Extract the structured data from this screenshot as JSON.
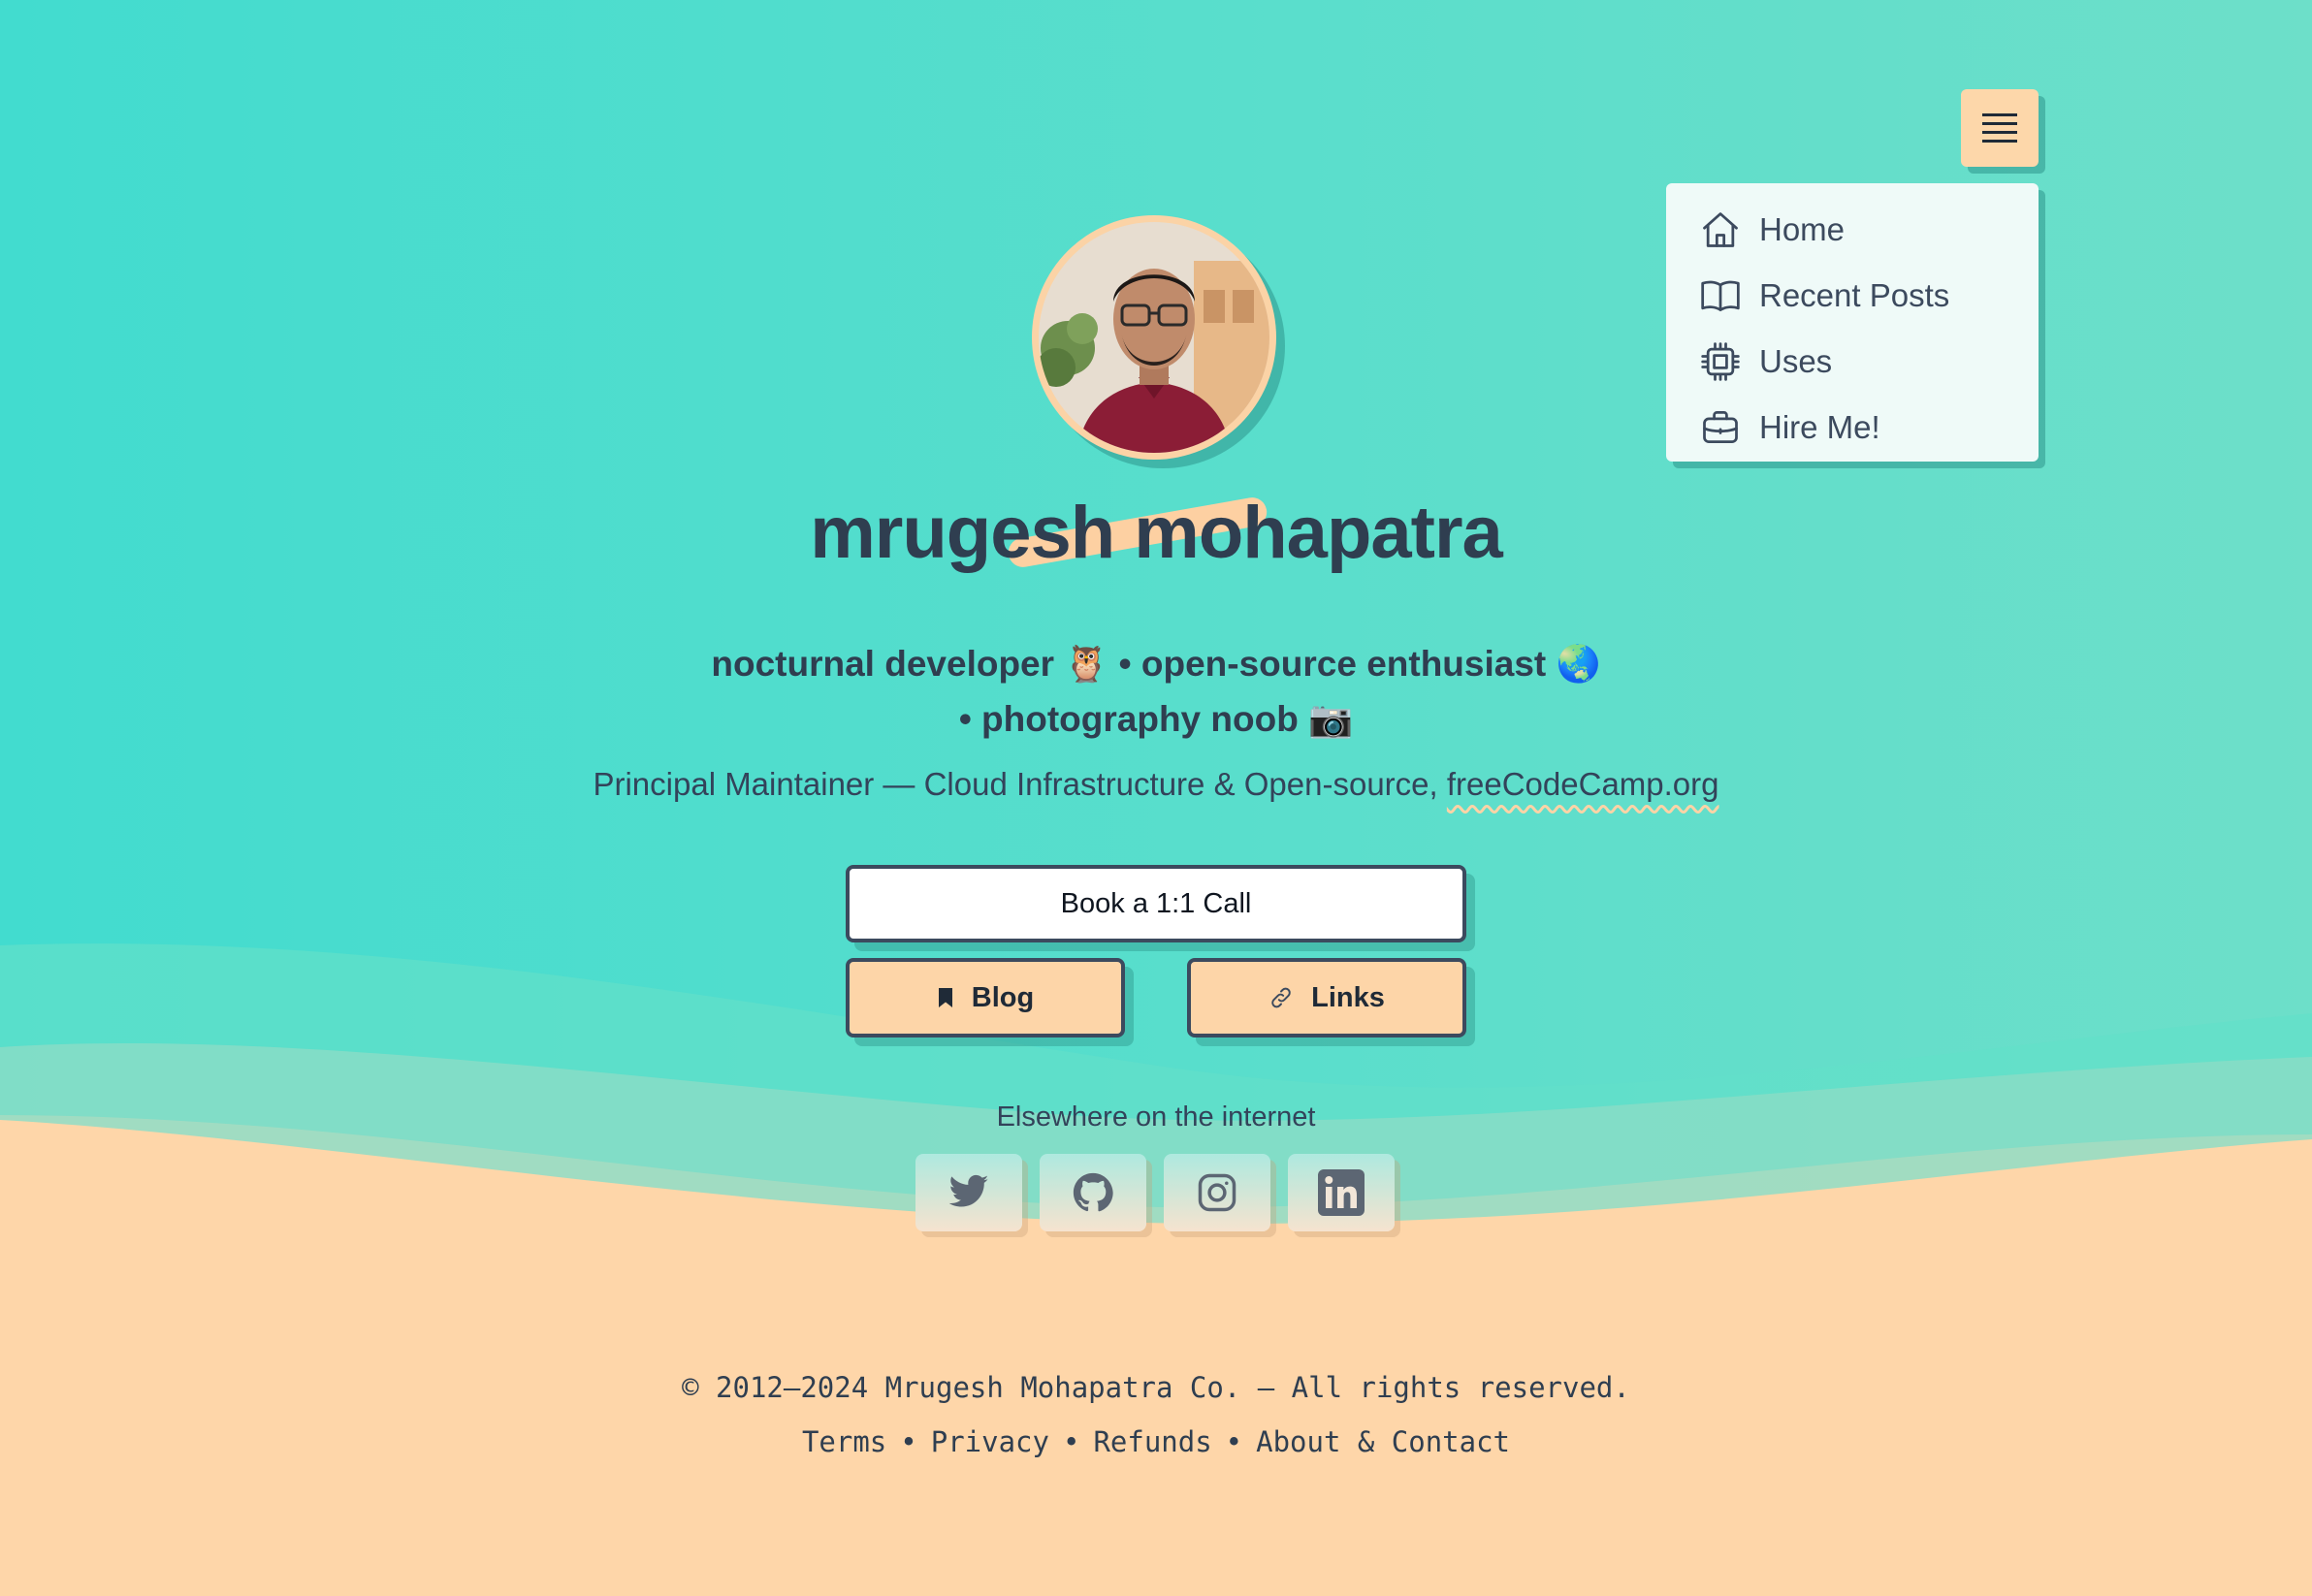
{
  "menu": {
    "items": [
      {
        "label": "Home",
        "icon": "home-icon"
      },
      {
        "label": "Recent Posts",
        "icon": "book-open-icon"
      },
      {
        "label": "Uses",
        "icon": "chip-icon"
      },
      {
        "label": "Hire Me!",
        "icon": "briefcase-icon"
      }
    ]
  },
  "profile": {
    "name": "mrugesh mohapatra",
    "tagline_line1": "nocturnal developer 🦉 • open-source enthusiast 🌏",
    "tagline_line2": "• photography noob 📷",
    "role_prefix": "Principal Maintainer — Cloud Infrastructure & Open-source, ",
    "role_link": "freeCodeCamp.org"
  },
  "buttons": {
    "call": "Book a 1:1 Call",
    "blog": "Blog",
    "links": "Links"
  },
  "elsewhere": {
    "label": "Elsewhere on the internet",
    "icons": [
      "twitter-icon",
      "github-icon",
      "instagram-icon",
      "linkedin-icon"
    ]
  },
  "footer": {
    "copyright": "© 2012–2024 Mrugesh Mohapatra Co. — All rights reserved.",
    "links": [
      "Terms",
      "Privacy",
      "Refunds",
      "About & Contact"
    ],
    "separator": "•"
  },
  "colors": {
    "teal": "#44ddd0",
    "peach": "#fed6a9",
    "text": "#2f3e50",
    "menu_bg": "#effaf8"
  }
}
